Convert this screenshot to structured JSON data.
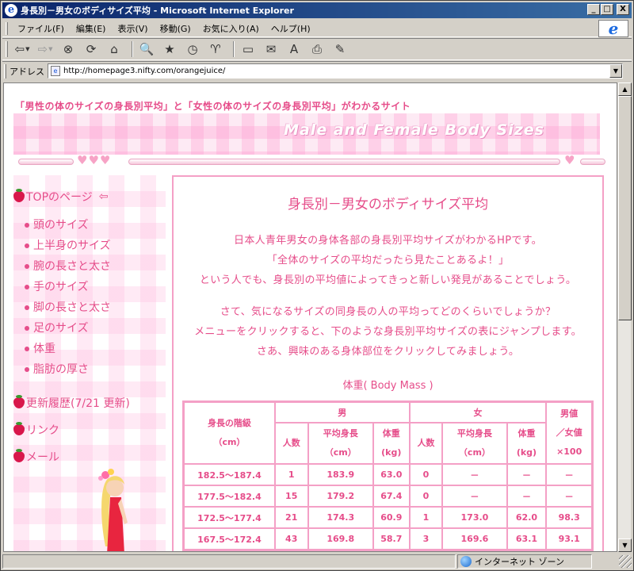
{
  "window": {
    "title": "身長別－男女のボディサイズ平均 - Microsoft Internet Explorer",
    "controls": {
      "minimize": "_",
      "maximize": "□",
      "close": "X"
    }
  },
  "menu": [
    "ファイル(F)",
    "編集(E)",
    "表示(V)",
    "移動(G)",
    "お気に入り(A)",
    "ヘルプ(H)"
  ],
  "address": {
    "label": "アドレス",
    "url": "http://homepage3.nifty.com/orangejuice/"
  },
  "page": {
    "tagline": "「男性の体のサイズの身長別平均」と「女性の体のサイズの身長別平均」がわかるサイト",
    "banner_title": "Male and Female Body Sizes",
    "hearts_left": "♥♥♥",
    "hearts_right": "♥",
    "sidebar": {
      "top": "TOPのページ",
      "items": [
        "頭のサイズ",
        "上半身のサイズ",
        "腕の長さと太さ",
        "手のサイズ",
        "脚の長さと太さ",
        "足のサイズ",
        "体重",
        "脂肪の厚さ"
      ],
      "history": "更新履歴(7/21 更新)",
      "link": "リンク",
      "mail": "メール"
    },
    "main": {
      "title": "身長別－男女のボディサイズ平均",
      "intro": [
        "日本人青年男女の身体各部の身長別平均サイズがわかるHPです。",
        "「全体のサイズの平均だったら見たことあるよ！」",
        "という人でも、身長別の平均値によってきっと新しい発見があることでしょう。"
      ],
      "guide": [
        "さて、気になるサイズの同身長の人の平均ってどのくらいでしょうか？",
        "メニューをクリックすると、下のような身長別平均サイズの表にジャンプします。",
        "さあ、興味のある身体部位をクリックしてみましょう。"
      ],
      "table_title": "体重( Body Mass )",
      "table": {
        "h_height": "身長の階級",
        "h_height_unit": "（cm）",
        "h_male": "男",
        "h_female": "女",
        "h_ratio": "男値",
        "h_ratio2": "／女値",
        "h_ratio3": "×100",
        "h_count": "人数",
        "h_avg_height": "平均身長",
        "h_avg_unit": "（cm）",
        "h_weight": "体重",
        "h_weight_unit": "(kg)",
        "rows": [
          [
            "182.5～187.4",
            "1",
            "183.9",
            "63.0",
            "0",
            "－",
            "－",
            "－"
          ],
          [
            "177.5～182.4",
            "15",
            "179.2",
            "67.4",
            "0",
            "－",
            "－",
            "－"
          ],
          [
            "172.5～177.4",
            "21",
            "174.3",
            "60.9",
            "1",
            "173.0",
            "62.0",
            "98.3"
          ],
          [
            "167.5～172.4",
            "43",
            "169.8",
            "58.7",
            "3",
            "169.6",
            "63.1",
            "93.1"
          ]
        ]
      }
    }
  },
  "status": {
    "zone": "インターネット ゾーン"
  }
}
